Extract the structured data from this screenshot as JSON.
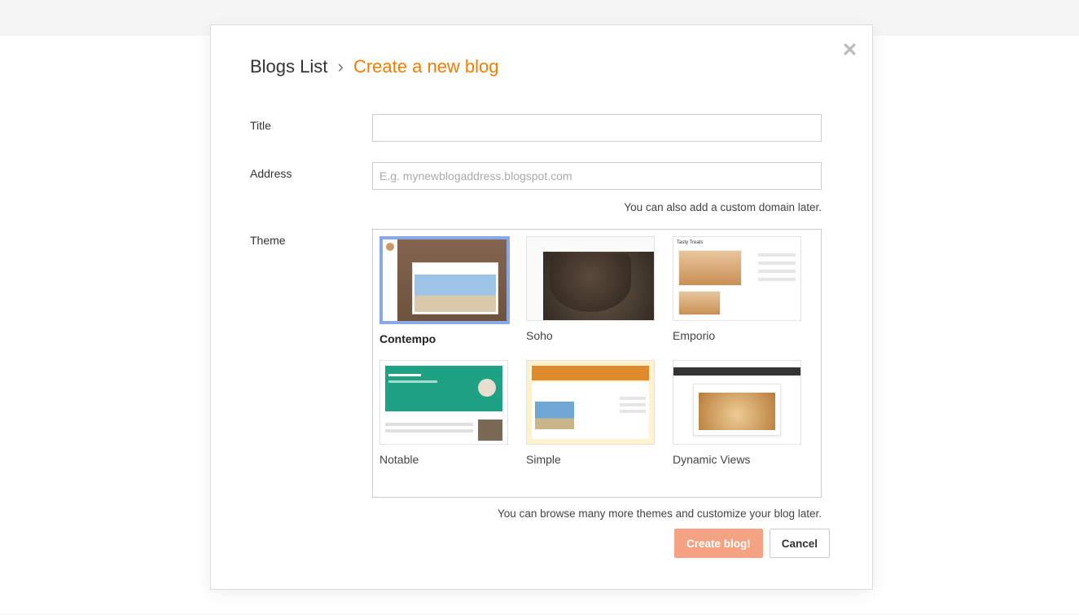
{
  "dialog": {
    "breadcrumb_parent": "Blogs List",
    "breadcrumb_sep": "›",
    "breadcrumb_current": "Create a new blog"
  },
  "fields": {
    "title_label": "Title",
    "title_value": "",
    "address_label": "Address",
    "address_value": "",
    "address_placeholder": "E.g. mynewblogaddress.blogspot.com",
    "address_hint": "You can also add a custom domain later.",
    "theme_label": "Theme",
    "theme_hint": "You can browse many more themes and customize your blog later."
  },
  "themes": [
    {
      "name": "Contempo",
      "selected": true
    },
    {
      "name": "Soho",
      "selected": false
    },
    {
      "name": "Emporio",
      "selected": false
    },
    {
      "name": "Notable",
      "selected": false
    },
    {
      "name": "Simple",
      "selected": false
    },
    {
      "name": "Dynamic Views",
      "selected": false
    }
  ],
  "buttons": {
    "create": "Create blog!",
    "cancel": "Cancel"
  }
}
